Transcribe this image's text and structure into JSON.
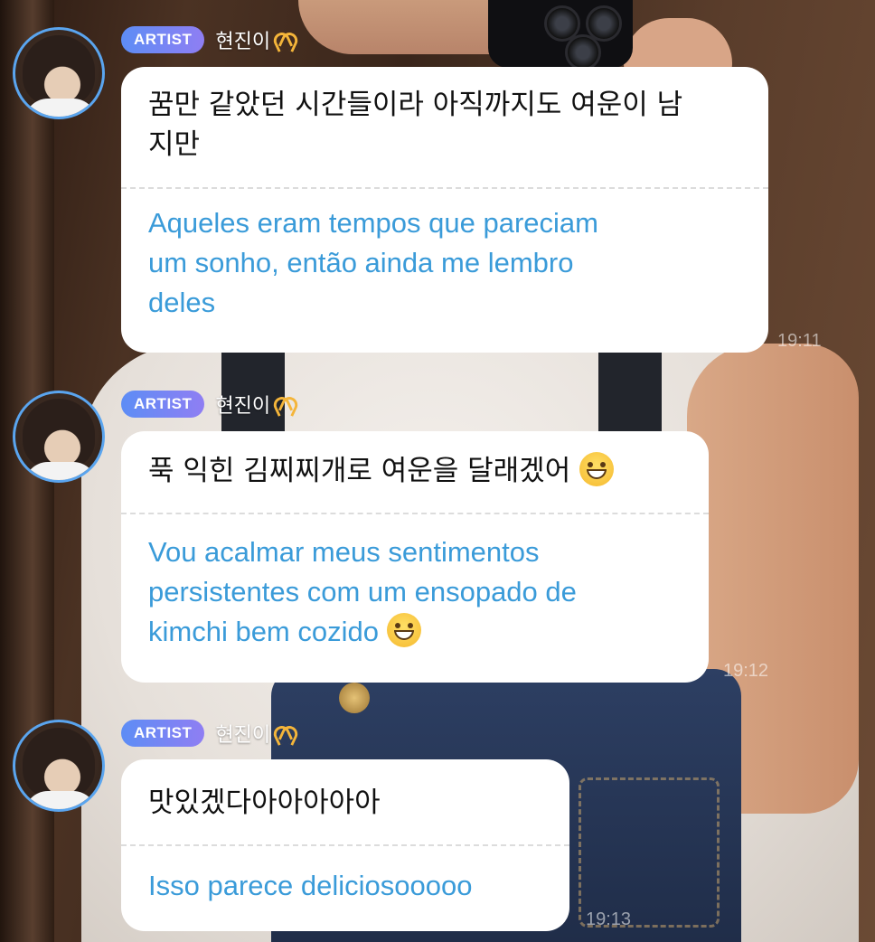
{
  "messages": [
    {
      "badge": "ARTIST",
      "sender": "현진이",
      "korean": "꿈만 같았던 시간들이라 아직까지도 여운이 남지만",
      "korean_lines": [
        "꿈만 같았던 시간들이라 아직까지도 여운이 남",
        "지만"
      ],
      "translation_lines": [
        "Aqueles eram tempos que pareciam",
        "um sonho, então ainda me lembro",
        "deles"
      ],
      "time": "19:11"
    },
    {
      "badge": "ARTIST",
      "sender": "현진이",
      "korean_lines": [
        "푹 익힌 김찌찌개로 여운을 달래겠어"
      ],
      "translation_lines": [
        "Vou acalmar meus sentimentos",
        "persistentes com um ensopado de",
        "kimchi bem cozido"
      ],
      "time": "19:12"
    },
    {
      "badge": "ARTIST",
      "sender": "현진이",
      "korean_lines": [
        "맛있겠다아아아아아"
      ],
      "translation_lines": [
        "Isso parece deliciosooooo"
      ],
      "time": "19:13"
    }
  ],
  "icons": {
    "sender_suffix": "heart-hands-icon",
    "emoji": "grinning-face-icon"
  },
  "colors": {
    "translation_text": "#3a9bd9",
    "avatar_ring": "#5aa5ef",
    "badge_gradient": [
      "#5d8df5",
      "#8f7ef3"
    ]
  }
}
